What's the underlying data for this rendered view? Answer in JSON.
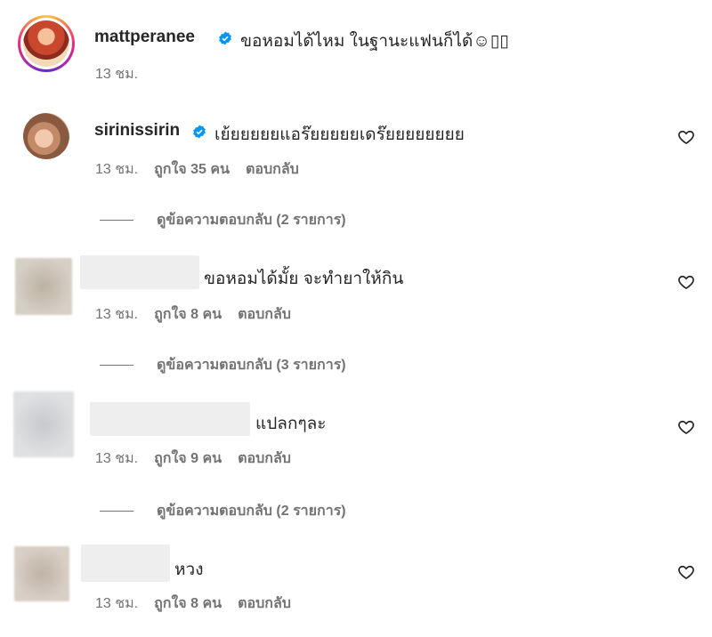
{
  "post": {
    "username": "mattperanee",
    "caption": "ขอหอมได้ไหม ในฐานะแฟนก็ได้☺▯▯",
    "time": "13 ชม."
  },
  "comments": [
    {
      "username": "sirinissirin",
      "text": "เย้ยยยยยแอร๊ยยยยยเดร๊ยยยยยยยย",
      "time": "13 ชม.",
      "likes": "ถูกใจ 35 คน",
      "reply": "ตอบกลับ",
      "view_replies": "ดูข้อความตอบกลับ (2 รายการ)"
    },
    {
      "username": "",
      "text": "ขอหอมได้มั้ย จะทำยาให้กิน",
      "time": "13 ชม.",
      "likes": "ถูกใจ 8 คน",
      "reply": "ตอบกลับ",
      "view_replies": "ดูข้อความตอบกลับ (3 รายการ)"
    },
    {
      "username": "",
      "text": "แปลกๆละ",
      "time": "13 ชม.",
      "likes": "ถูกใจ 9 คน",
      "reply": "ตอบกลับ",
      "view_replies": "ดูข้อความตอบกลับ (2 รายการ)"
    },
    {
      "username": "",
      "text": "หวง",
      "time": "13 ชม.",
      "likes": "ถูกใจ 8 คน",
      "reply": "ตอบกลับ"
    }
  ],
  "icons": {
    "verified": "verified-badge-icon",
    "like": "heart-outline-icon"
  },
  "colors": {
    "verified": "#0095f6",
    "text": "#262626",
    "secondary": "#737373"
  }
}
